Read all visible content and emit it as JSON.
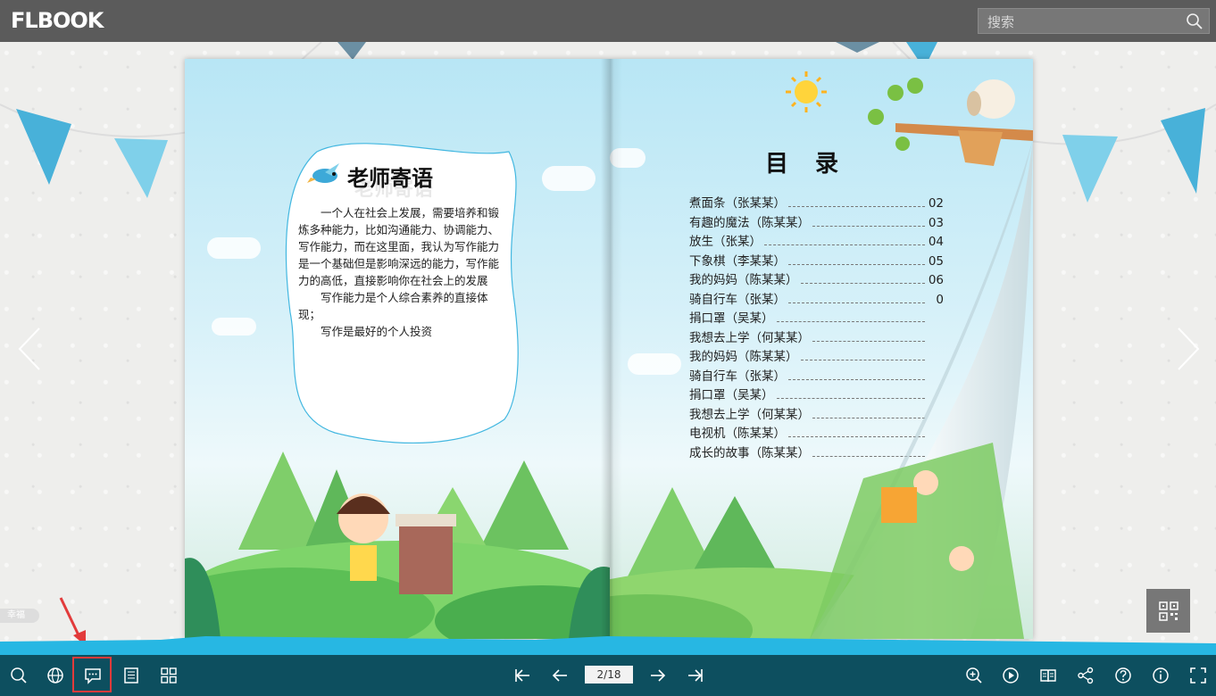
{
  "app": {
    "logo_text": "FLBOOK"
  },
  "search": {
    "placeholder": "搜索"
  },
  "left_page": {
    "title": "老师寄语",
    "title_shadow": "老师寄语",
    "paragraphs": [
      "一个人在社会上发展，需要培养和锻炼多种能力，比如沟通能力、协调能力、写作能力，而在这里面，我认为写作能力是一个基础但是影响深远的能力，写作能力的高低，直接影响你在社会上的发展",
      "写作能力是个人综合素养的直接体现；",
      "写作是最好的个人投资"
    ]
  },
  "right_page": {
    "toc_title": "目录",
    "toc": [
      {
        "label": "煮面条（张某某）",
        "page": "02"
      },
      {
        "label": "有趣的魔法（陈某某）",
        "page": "03"
      },
      {
        "label": "放生（张某）",
        "page": "04"
      },
      {
        "label": "下象棋（李某某）",
        "page": "05"
      },
      {
        "label": "我的妈妈（陈某某）",
        "page": "06"
      },
      {
        "label": "骑自行车（张某）",
        "page": "0"
      },
      {
        "label": "捐口罩（吴某）",
        "page": ""
      },
      {
        "label": "我想去上学（何某某）",
        "page": ""
      },
      {
        "label": "我的妈妈（陈某某）",
        "page": ""
      },
      {
        "label": "骑自行车（张某）",
        "page": ""
      },
      {
        "label": "捐口罩（吴某）",
        "page": ""
      },
      {
        "label": "我想去上学（何某某）",
        "page": ""
      },
      {
        "label": "电视机（陈某某）",
        "page": ""
      },
      {
        "label": "成长的故事（陈某某）",
        "page": ""
      }
    ]
  },
  "side_tag": "幸福",
  "toolbar": {
    "page_indicator": "2/18",
    "left_icons": [
      "search-icon",
      "globe-icon",
      "comment-icon",
      "document-icon",
      "grid-icon"
    ],
    "center_icons": [
      "first-page-icon",
      "prev-page-icon",
      "next-page-icon",
      "last-page-icon"
    ],
    "right_icons": [
      "zoom-in-icon",
      "play-icon",
      "book-icon",
      "share-icon",
      "help-icon",
      "info-icon",
      "fullscreen-icon"
    ]
  },
  "colors": {
    "topbar": "#5b5b5b",
    "bottombar": "#0d4f5f",
    "wave": "#27b7e3",
    "highlight": "#e23b3b"
  }
}
